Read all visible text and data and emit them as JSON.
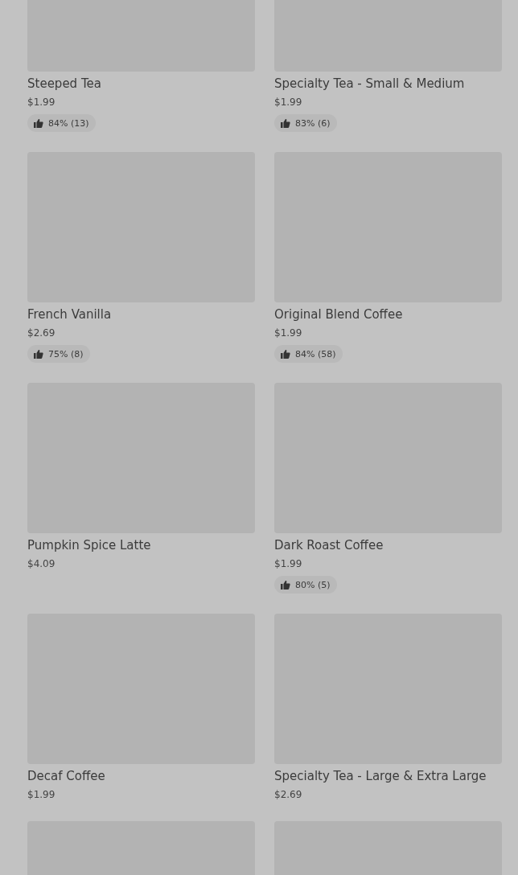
{
  "products": [
    {
      "kind": "product",
      "name": "Steeped Tea",
      "price": "$1.99",
      "rating": "84% (13)"
    },
    {
      "kind": "product",
      "name": "Specialty Tea - Small & Medium",
      "price": "$1.99",
      "rating": "83% (6)"
    },
    {
      "kind": "product",
      "name": "French Vanilla",
      "price": "$2.69",
      "rating": "75% (8)"
    },
    {
      "kind": "product",
      "name": "Original Blend Coffee",
      "price": "$1.99",
      "rating": "84% (58)"
    },
    {
      "kind": "product",
      "name": "Pumpkin Spice Latte",
      "price": "$4.09"
    },
    {
      "kind": "product",
      "name": "Dark Roast Coffee",
      "price": "$1.99",
      "rating": "80% (5)"
    },
    {
      "kind": "product",
      "name": "Decaf Coffee",
      "price": "$1.99"
    },
    {
      "kind": "product",
      "name": "Specialty Tea - Large & Extra Large",
      "price": "$2.69"
    },
    {
      "kind": "image-only"
    },
    {
      "kind": "image-only"
    }
  ]
}
